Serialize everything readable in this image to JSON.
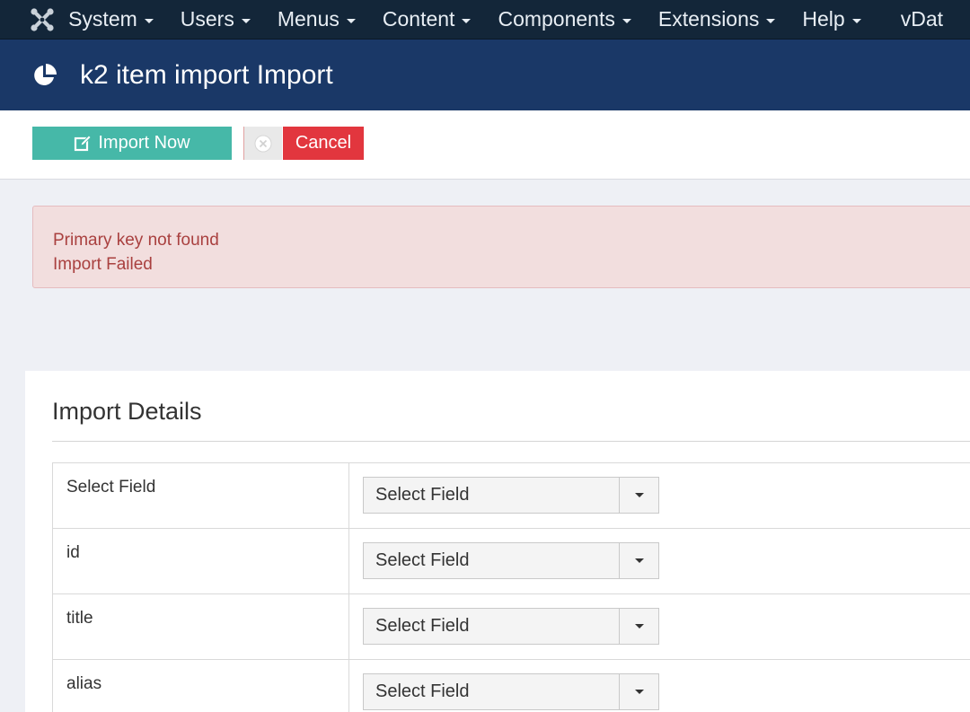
{
  "nav": {
    "items": [
      {
        "label": "System"
      },
      {
        "label": "Users"
      },
      {
        "label": "Menus"
      },
      {
        "label": "Content"
      },
      {
        "label": "Components"
      },
      {
        "label": "Extensions"
      },
      {
        "label": "Help"
      },
      {
        "label": "vDat"
      }
    ]
  },
  "header": {
    "title": "k2 item import Import"
  },
  "toolbar": {
    "import_label": "Import Now",
    "cancel_label": "Cancel"
  },
  "alert": {
    "messages": [
      "Primary key not found",
      "Import Failed"
    ]
  },
  "panel": {
    "title": "Import Details",
    "rows": [
      {
        "label": "Select Field",
        "value": "Select Field"
      },
      {
        "label": "id",
        "value": "Select Field"
      },
      {
        "label": "title",
        "value": "Select Field"
      },
      {
        "label": "alias",
        "value": "Select Field"
      }
    ]
  },
  "colors": {
    "nav_bg": "#132639",
    "header_bg": "#1a3867",
    "import_button": "#46b8a8",
    "cancel_button": "#e2363e",
    "alert_bg": "#f2dede",
    "alert_text": "#a9403f"
  },
  "icons": {
    "logo": "joomla-logo-icon",
    "title": "pie-chart-icon",
    "import": "edit-icon",
    "cancel": "close-circle-icon"
  }
}
